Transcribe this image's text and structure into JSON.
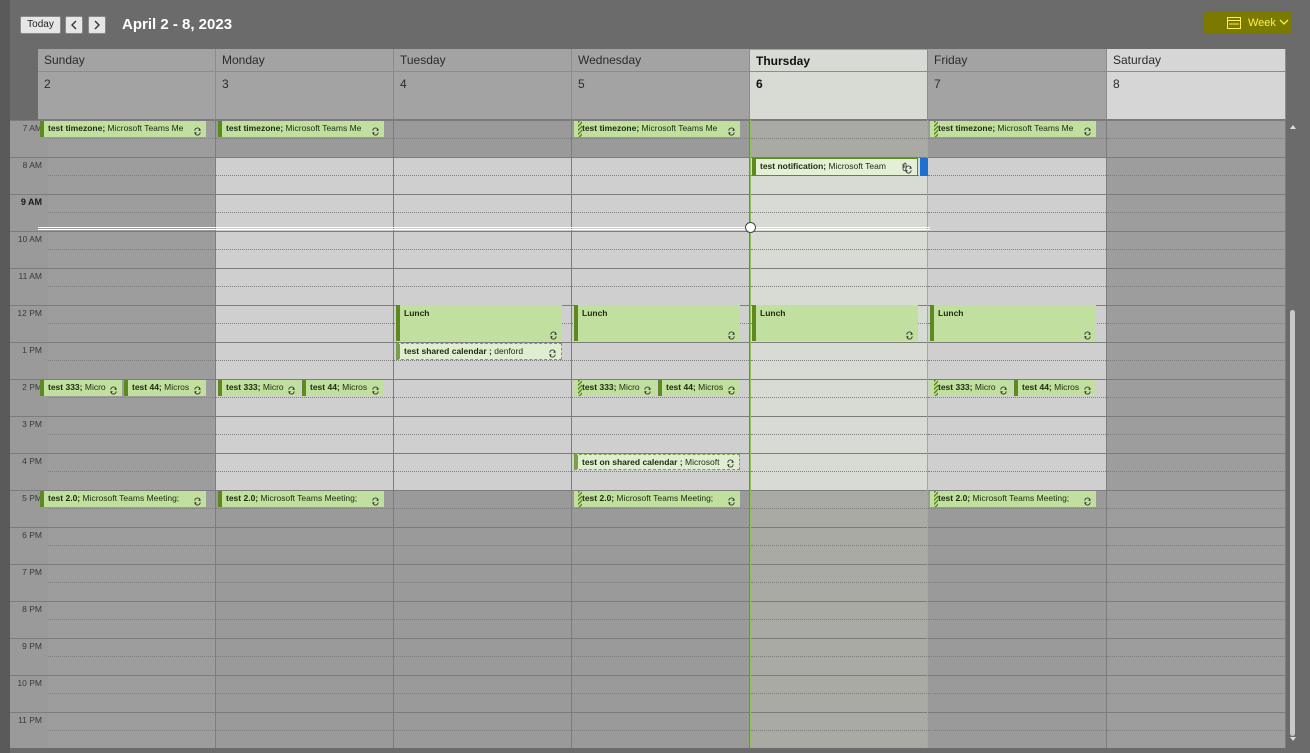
{
  "header": {
    "today_label": "Today",
    "date_range": "April 2 - 8, 2023",
    "view_label": "Week"
  },
  "days": [
    {
      "name": "Sunday",
      "num": "2",
      "today": false
    },
    {
      "name": "Monday",
      "num": "3",
      "today": false
    },
    {
      "name": "Tuesday",
      "num": "4",
      "today": false
    },
    {
      "name": "Wednesday",
      "num": "5",
      "today": false
    },
    {
      "name": "Thursday",
      "num": "6",
      "today": true
    },
    {
      "name": "Friday",
      "num": "7",
      "today": false
    },
    {
      "name": "Saturday",
      "num": "8",
      "today": false
    }
  ],
  "times": [
    "7 AM",
    "8 AM",
    "9 AM",
    "10 AM",
    "11 AM",
    "12 PM",
    "1 PM",
    "2 PM",
    "3 PM",
    "4 PM",
    "5 PM",
    "6 PM",
    "7 PM",
    "8 PM",
    "9 PM",
    "10 PM",
    "11 PM"
  ],
  "events": {
    "timezone": {
      "bold": "test timezone;",
      "rest": " Microsoft Teams Me"
    },
    "notification": {
      "bold": "test notification;",
      "rest": " Microsoft Team"
    },
    "lunch": {
      "bold": "Lunch",
      "rest": ""
    },
    "shared": {
      "bold": "test shared calendar ;",
      "rest": " denford"
    },
    "e333": {
      "bold": "test 333;",
      "rest": " Micro"
    },
    "e44": {
      "bold": "test 44;",
      "rest": " Micros"
    },
    "on_shared": {
      "bold": "test on shared calendar ;",
      "rest": " Microsoft"
    },
    "e20": {
      "bold": "test 2.0;",
      "rest": " Microsoft Teams Meeting;"
    }
  },
  "colors": {
    "event_fill": "#c1df9f",
    "event_border": "#5c8a1c",
    "today_bg": "#d8dad4",
    "weekend_bg": "#9d9d9d",
    "work_hours_bg": "#cfcfcf",
    "off_hours_bg": "#9a9a9a",
    "view_button": "#7a7a00",
    "now_marker": "#ffffff"
  }
}
